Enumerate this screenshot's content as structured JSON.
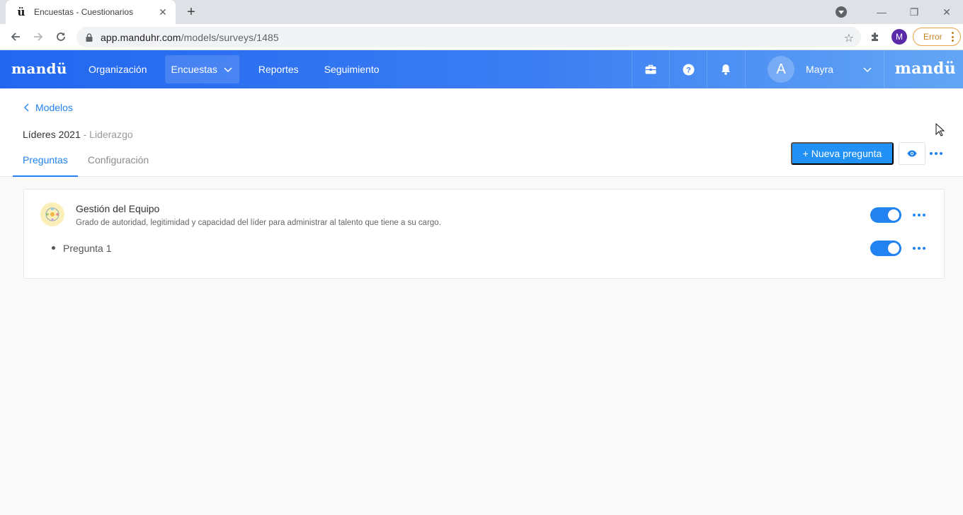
{
  "browser": {
    "tab_title": "Encuestas - Cuestionarios",
    "favicon_glyph": "ü",
    "url_host": "app.manduhr.com",
    "url_path": "/models/surveys/1485",
    "profile_initial": "M",
    "error_label": "Error"
  },
  "app": {
    "logo": "mandü",
    "nav": [
      {
        "label": "Organización"
      },
      {
        "label": "Encuestas",
        "active": true
      },
      {
        "label": "Reportes"
      },
      {
        "label": "Seguimiento"
      }
    ],
    "icons": [
      "briefcase-icon",
      "help-icon",
      "bell-icon"
    ],
    "user": {
      "avatar_initial": "A",
      "name": "Mayra"
    },
    "colors": {
      "header_start": "#2167f0",
      "header_end": "#63a6f5",
      "accent": "#2283f0"
    }
  },
  "page": {
    "back_label": "Modelos",
    "title": "Líderes 2021",
    "subtitle": "- Liderazgo",
    "tabs": [
      {
        "label": "Preguntas",
        "active": true
      },
      {
        "label": "Configuración"
      }
    ],
    "new_question_label": "+ Nueva pregunta"
  },
  "section": {
    "title": "Gestión del Equipo",
    "description": "Grado de autoridad, legitimidad y capacidad del líder para administrar al talento que tiene a su cargo.",
    "enabled": true,
    "questions": [
      {
        "label": "Pregunta 1",
        "enabled": true
      }
    ]
  }
}
